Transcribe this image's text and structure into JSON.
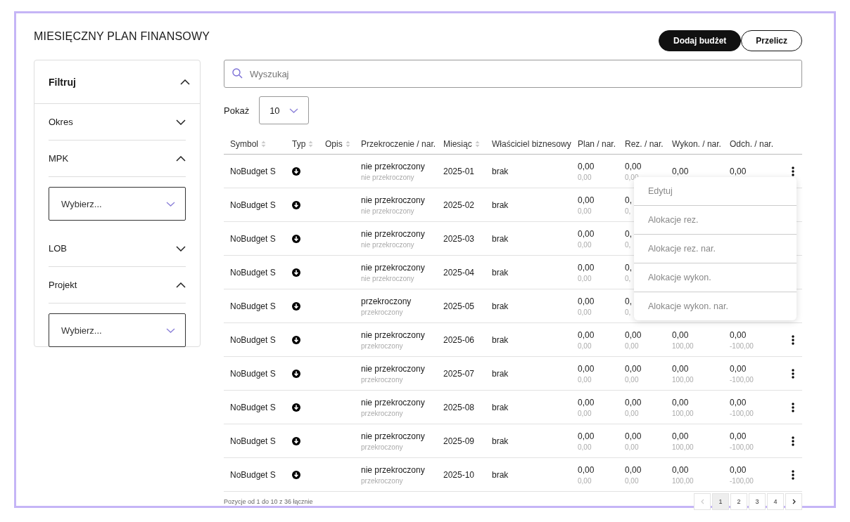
{
  "title": "MIESIĘCZNY PLAN FINANSOWY",
  "buttons": [
    {
      "label": "Dodaj budżet",
      "kind": "primary"
    },
    {
      "label": "Przelicz",
      "kind": "secondary"
    }
  ],
  "filter": {
    "title": "Filtruj",
    "expanded": true,
    "sections": [
      {
        "label": "Okres",
        "expanded": false
      },
      {
        "label": "MPK",
        "expanded": true,
        "select": {
          "placeholder": "Wybierz..."
        }
      },
      {
        "label": "LOB",
        "expanded": false
      },
      {
        "label": "Projekt",
        "expanded": true,
        "select": {
          "placeholder": "Wybierz..."
        }
      }
    ]
  },
  "search": {
    "placeholder": "Wyszukaj"
  },
  "page_size": {
    "label": "Pokaż",
    "value": "10"
  },
  "table": {
    "columns": [
      {
        "label": "Symbol",
        "sortable": true
      },
      {
        "label": "Typ",
        "sortable": true
      },
      {
        "label": "Opis",
        "sortable": true
      },
      {
        "label": "Przekroczenie / nar.",
        "sortable": false
      },
      {
        "label": "Miesiąc",
        "sortable": true
      },
      {
        "label": "Właściciel biznesowy",
        "sortable": false
      },
      {
        "label": "Plan / nar.",
        "sortable": false
      },
      {
        "label": "Rez. / nar.",
        "sortable": false
      },
      {
        "label": "Wykon. / nar.",
        "sortable": false
      },
      {
        "label": "Odch. / nar.",
        "sortable": false
      }
    ],
    "rows": [
      {
        "symbol": "NoBudget S",
        "overrun": "nie przekroczony",
        "overrun_nar": "nie przekroczony",
        "month": "2025-01",
        "owner": "brak",
        "plan": "0,00",
        "plan_nar": "0,00",
        "rez": "0,00",
        "rez_nar": "0,00",
        "wyk": "0,00",
        "odch": "0,00",
        "menu_open": true
      },
      {
        "symbol": "NoBudget S",
        "overrun": "nie przekroczony",
        "overrun_nar": "nie przekroczony",
        "month": "2025-02",
        "owner": "brak",
        "plan": "0,00",
        "plan_nar": "0,00",
        "rez": "0,",
        "rez_nar": "0,",
        "menu_open": false
      },
      {
        "symbol": "NoBudget S",
        "overrun": "nie przekroczony",
        "overrun_nar": "nie przekroczony",
        "month": "2025-03",
        "owner": "brak",
        "plan": "0,00",
        "plan_nar": "0,00",
        "rez": "0,",
        "rez_nar": "0,",
        "menu_open": false
      },
      {
        "symbol": "NoBudget S",
        "overrun": "nie przekroczony",
        "overrun_nar": "nie przekroczony",
        "month": "2025-04",
        "owner": "brak",
        "plan": "0,00",
        "plan_nar": "0,00",
        "rez": "0,",
        "rez_nar": "0,",
        "menu_open": false
      },
      {
        "symbol": "NoBudget S",
        "overrun": "przekroczony",
        "overrun_nar": "przekroczony",
        "month": "2025-05",
        "owner": "brak",
        "plan": "0,00",
        "plan_nar": "0,00",
        "rez": "0,",
        "rez_nar": "0,",
        "menu_open": false
      },
      {
        "symbol": "NoBudget S",
        "overrun": "nie przekroczony",
        "overrun_nar": "przekroczony",
        "month": "2025-06",
        "owner": "brak",
        "plan": "0,00",
        "plan_nar": "0,00",
        "rez": "0,00",
        "rez_nar": "0,00",
        "wyk": "0,00",
        "wyk_nar": "100,00",
        "odch": "0,00",
        "odch_nar": "-100,00",
        "menu_open": false
      },
      {
        "symbol": "NoBudget S",
        "overrun": "nie przekroczony",
        "overrun_nar": "przekroczony",
        "month": "2025-07",
        "owner": "brak",
        "plan": "0,00",
        "plan_nar": "0,00",
        "rez": "0,00",
        "rez_nar": "0,00",
        "wyk": "0,00",
        "wyk_nar": "100,00",
        "odch": "0,00",
        "odch_nar": "-100,00",
        "menu_open": false
      },
      {
        "symbol": "NoBudget S",
        "overrun": "nie przekroczony",
        "overrun_nar": "przekroczony",
        "month": "2025-08",
        "owner": "brak",
        "plan": "0,00",
        "plan_nar": "0,00",
        "rez": "0,00",
        "rez_nar": "0,00",
        "wyk": "0,00",
        "wyk_nar": "100,00",
        "odch": "0,00",
        "odch_nar": "-100,00",
        "menu_open": false
      },
      {
        "symbol": "NoBudget S",
        "overrun": "nie przekroczony",
        "overrun_nar": "przekroczony",
        "month": "2025-09",
        "owner": "brak",
        "plan": "0,00",
        "plan_nar": "0,00",
        "rez": "0,00",
        "rez_nar": "0,00",
        "wyk": "0,00",
        "wyk_nar": "100,00",
        "odch": "0,00",
        "odch_nar": "-100,00",
        "menu_open": false
      },
      {
        "symbol": "NoBudget S",
        "overrun": "nie przekroczony",
        "overrun_nar": "przekroczony",
        "month": "2025-10",
        "owner": "brak",
        "plan": "0,00",
        "plan_nar": "0,00",
        "rez": "0,00",
        "rez_nar": "0,00",
        "wyk": "0,00",
        "wyk_nar": "100,00",
        "odch": "0,00",
        "odch_nar": "-100,00",
        "menu_open": false
      }
    ],
    "row_menu": [
      "Edytuj",
      "Alokacje rez.",
      "Alokacje rez. nar.",
      "Alokacje wykon.",
      "Alokacje wykon. nar."
    ]
  },
  "summary": "Pozycje od 1 do 10 z 36 łącznie",
  "pagination": [
    {
      "label": "1",
      "selected": true
    },
    {
      "label": "2",
      "selected": false
    },
    {
      "label": "3",
      "selected": false
    },
    {
      "label": "4",
      "selected": false
    }
  ],
  "pagination_prev_disabled": true
}
